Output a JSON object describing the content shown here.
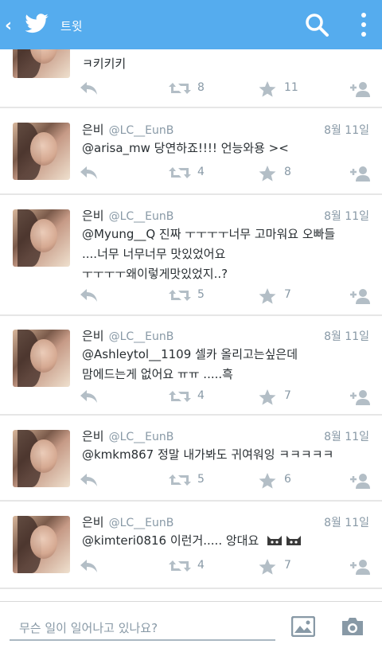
{
  "app": {
    "title": "트윗",
    "accent": "#55acee",
    "back_icon": "chevron-left-icon",
    "logo_icon": "twitter-bird-icon",
    "search_icon": "search-icon",
    "menu_icon": "overflow-menu-icon"
  },
  "tweets": [
    {
      "name": "",
      "handle": "",
      "date": "",
      "lines": [
        "ㅋ키키키"
      ],
      "retweets": "8",
      "favorites": "11"
    },
    {
      "name": "은비",
      "handle": "@LC__EunB",
      "date": "8월 11일",
      "lines": [
        "@arisa_mw 당연하죠!!!! 언능와용 ><"
      ],
      "retweets": "4",
      "favorites": "8"
    },
    {
      "name": "은비",
      "handle": "@LC__EunB",
      "date": "8월 11일",
      "lines": [
        "@Myung__Q 진짜 ㅜㅜㅜㅜ너무 고마워요 오빠들",
        "....너무 너무너무 맛있었어요",
        "ㅜㅜㅜㅜ왜이렇게맛있었지..?"
      ],
      "retweets": "5",
      "favorites": "7"
    },
    {
      "name": "은비",
      "handle": "@LC__EunB",
      "date": "8월 11일",
      "lines": [
        "@Ashleytol__1109 셀카 올리고는싶은데",
        "맘에드는게 없어요 ㅠㅠ .....흑"
      ],
      "retweets": "4",
      "favorites": "7"
    },
    {
      "name": "은비",
      "handle": "@LC__EunB",
      "date": "8월 11일",
      "lines": [
        "@kmkm867 정말 내가봐도 귀여워잉 ㅋㅋㅋㅋㅋ"
      ],
      "retweets": "5",
      "favorites": "6"
    },
    {
      "name": "은비",
      "handle": "@LC__EunB",
      "date": "8월 11일",
      "lines": [
        "@kimteri0816 이런거..... 앙대요"
      ],
      "retweets": "4",
      "favorites": "7"
    }
  ],
  "compose": {
    "placeholder": "무슨 일이 일어나고 있나요?",
    "image_icon": "image-icon",
    "camera_icon": "camera-icon"
  }
}
